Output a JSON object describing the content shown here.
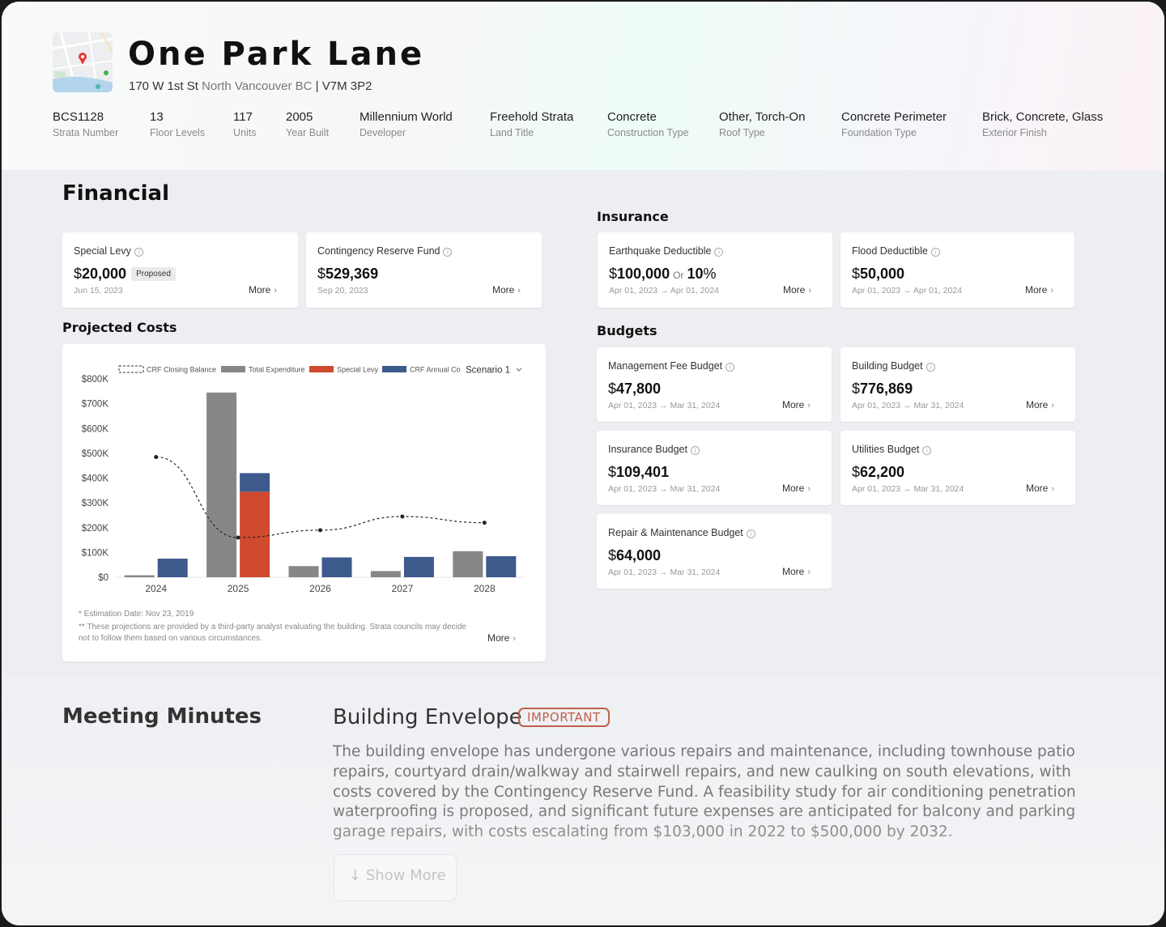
{
  "property": {
    "name": "One Park Lane",
    "address_street": "170 W 1st St",
    "address_city": "North Vancouver BC",
    "address_sep": "|",
    "postal": "V7M 3P2"
  },
  "facts": [
    {
      "value": "BCS1128",
      "label": "Strata Number"
    },
    {
      "value": "13",
      "label": "Floor Levels"
    },
    {
      "value": "117",
      "label": "Units"
    },
    {
      "value": "2005",
      "label": "Year Built"
    },
    {
      "value": "Millennium World",
      "label": "Developer"
    },
    {
      "value": "Freehold Strata",
      "label": "Land Title"
    },
    {
      "value": "Concrete",
      "label": "Construction Type"
    },
    {
      "value": "Other, Torch-On",
      "label": "Roof Type"
    },
    {
      "value": "Concrete Perimeter",
      "label": "Foundation Type"
    },
    {
      "value": "Brick, Concrete, Glass",
      "label": "Exterior Finish"
    }
  ],
  "financial": {
    "title": "Financial",
    "special_levy": {
      "label": "Special Levy",
      "currency": "$",
      "amount": "20,000",
      "badge": "Proposed",
      "date": "Jun 15, 2023",
      "more": "More"
    },
    "crf": {
      "label": "Contingency Reserve Fund",
      "currency": "$",
      "amount": "529,369",
      "date": "Sep 20, 2023",
      "more": "More"
    }
  },
  "insurance": {
    "title": "Insurance",
    "earthquake": {
      "label": "Earthquake Deductible",
      "currency": "$",
      "amount": "100,000",
      "or": "Or",
      "pct_value": "10",
      "pct_sign": "%",
      "date": "Apr 01, 2023 → Apr 01, 2024",
      "more": "More"
    },
    "flood": {
      "label": "Flood Deductible",
      "currency": "$",
      "amount": "50,000",
      "date": "Apr 01, 2023 → Apr 01, 2024",
      "more": "More"
    }
  },
  "budgets": {
    "title": "Budgets",
    "management": {
      "label": "Management Fee Budget",
      "currency": "$",
      "amount": "47,800",
      "date": "Apr 01, 2023 → Mar 31, 2024",
      "more": "More"
    },
    "building": {
      "label": "Building Budget",
      "currency": "$",
      "amount": "776,869",
      "date": "Apr 01, 2023 → Mar 31, 2024",
      "more": "More"
    },
    "insurance": {
      "label": "Insurance Budget",
      "currency": "$",
      "amount": "109,401",
      "date": "Apr 01, 2023 → Mar 31, 2024",
      "more": "More"
    },
    "utilities": {
      "label": "Utilities Budget",
      "currency": "$",
      "amount": "62,200",
      "date": "Apr 01, 2023 → Mar 31, 2024",
      "more": "More"
    },
    "repair": {
      "label": "Repair & Maintenance Budget",
      "currency": "$",
      "amount": "64,000",
      "date": "Apr 01, 2023 → Mar 31, 2024",
      "more": "More"
    }
  },
  "projected": {
    "title": "Projected Costs",
    "scenario": "Scenario 1",
    "note1": "* Estimation Date: Nov 23, 2019",
    "note2": "** These projections are provided by a third-party analyst evaluating the building. Strata councils may decide not to follow them based on various circumstances.",
    "more": "More"
  },
  "chart_data": {
    "type": "bar",
    "categories": [
      "2024",
      "2025",
      "2026",
      "2027",
      "2028"
    ],
    "ylim": [
      0,
      800000
    ],
    "yticks": [
      "$0",
      "$100K",
      "$200K",
      "$300K",
      "$400K",
      "$500K",
      "$600K",
      "$700K",
      "$800K"
    ],
    "series": [
      {
        "name": "CRF Closing Balance",
        "kind": "line",
        "values": [
          485000,
          160000,
          190000,
          245000,
          220000
        ],
        "color": "#222222"
      },
      {
        "name": "Total Expenditure",
        "kind": "bar",
        "values": [
          8000,
          745000,
          45000,
          25000,
          105000
        ],
        "color": "#878787"
      },
      {
        "name": "Special Levy",
        "kind": "stack",
        "values": [
          0,
          345000,
          0,
          0,
          0
        ],
        "color": "#d04a2f"
      },
      {
        "name": "CRF Annual Co",
        "kind": "stack",
        "values": [
          75000,
          75000,
          80000,
          82000,
          85000
        ],
        "color": "#3c5a8c"
      }
    ],
    "grid": false,
    "legend": "top-left"
  },
  "meeting": {
    "title": "Meeting Minutes",
    "topic": "Building Envelope",
    "tag": "IMPORTANT",
    "body": "The building envelope has undergone various repairs and maintenance, including townhouse patio repairs, courtyard drain/walkway and stairwell repairs, and new caulking on south elevations, with costs covered by the Contingency Reserve Fund. A feasibility study for air conditioning penetration waterproofing is proposed, and significant future expenses are anticipated for balcony and parking garage repairs, with costs escalating from $103,000 in 2022 to $500,000 by 2032.",
    "show_more": "Show More"
  }
}
